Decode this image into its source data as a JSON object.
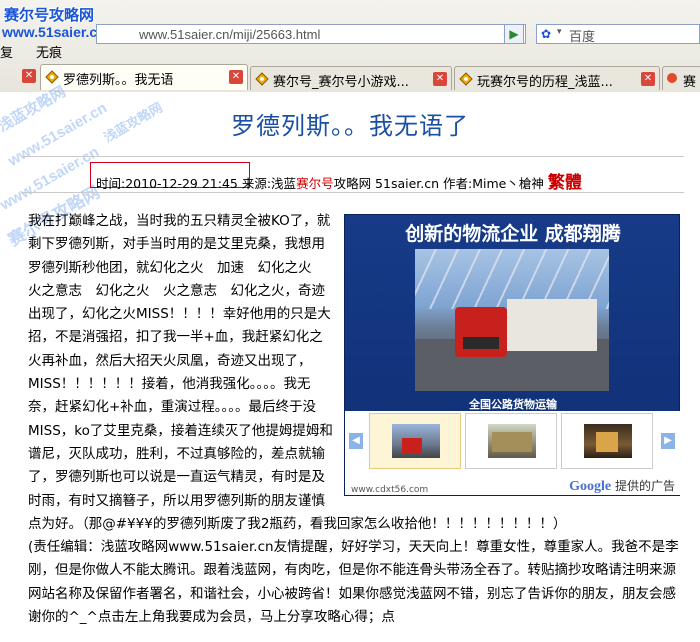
{
  "browser": {
    "url": "www.51saier.cn/miji/25663.html",
    "search_placeholder": "百度",
    "menu": [
      "复",
      "无痕"
    ],
    "watermark_logo": "赛尔号攻略网",
    "watermark_url": "www.51saier.cn",
    "tabs": [
      {
        "label": "罗德列斯。。我无语",
        "active": true
      },
      {
        "label": "赛尔号_赛尔号小游戏...",
        "active": false
      },
      {
        "label": "玩赛尔号的历程_浅蓝...",
        "active": false
      },
      {
        "label": "赛",
        "active": false
      }
    ]
  },
  "article": {
    "title": "罗德列斯。。我无语了",
    "time_label": "时间:",
    "time": "2010-12-29 21:45",
    "source_label": "来源:浅蓝",
    "source_highlight": "赛尔号",
    "source_rest": "攻略网 51saier.cn 作者:Mime丶槍神",
    "badge": "繁體",
    "body_1": "我在打巅峰之战，当时我的五只精灵全被KO了，就剩下罗德列斯，对手当时用的是艾里克桑，我想用罗德列斯秒他团，就幻化之火　加速　幻化之火　火之意志　幻化之火　火之意志　幻化之火，奇迹出现了，幻化之火MISS！！！！幸好他用的只是大招，不是消强招，扣了我一半+血，我赶紧幻化之火再补血，然后大招天火凤凰，奇迹又出现了，MISS！！！！！！接着，他消我强化。。。。我无奈，赶紧幻化+补血，重演过程。。。。最后终于没MISS，ko了艾里克桑，接着连续灭了他提姆提姆和谱尼，灭队成功，胜利，不过真够险的，差点就输了，罗德列斯也可以说是一直运气精灵，有时是及时雨，有时又摘簮子，所以用罗德列斯的朋友谨慎点为好。（那@#¥¥¥的罗德列斯废了我2瓶药，看我回家怎么收拾他！！！！！！！！！）",
    "editor_note": "(责任编辑：浅蓝攻略网www.51saier.cn友情提醒，好好学习，天天向上！尊重女性，尊重家人。我爸不是李刚，但是你做人不能太腾讯。跟着浅蓝网，有肉吃，但是你不能连骨头带汤全吞了。转贴摘抄攻略请注明来源网站名称及保留作者署名，和谐社会，小心被跨省！如果你感觉浅蓝网不错，别忘了告诉你的朋友，朋友会感谢你的^_^点击左上角我要成为会员，马上分享攻略心得；点"
  },
  "ad": {
    "title": "创新的物流企业 成都翔腾",
    "caption": "全国公路货物运输",
    "footer_url": "www.cdxt56.com",
    "footer_google": "Google",
    "footer_text": "提供的广告"
  },
  "watermarks": [
    "浅蓝攻略网",
    "www.51saier.cn",
    "浅蓝攻略网",
    "www.51saier.cn",
    "赛尔号攻略网"
  ]
}
